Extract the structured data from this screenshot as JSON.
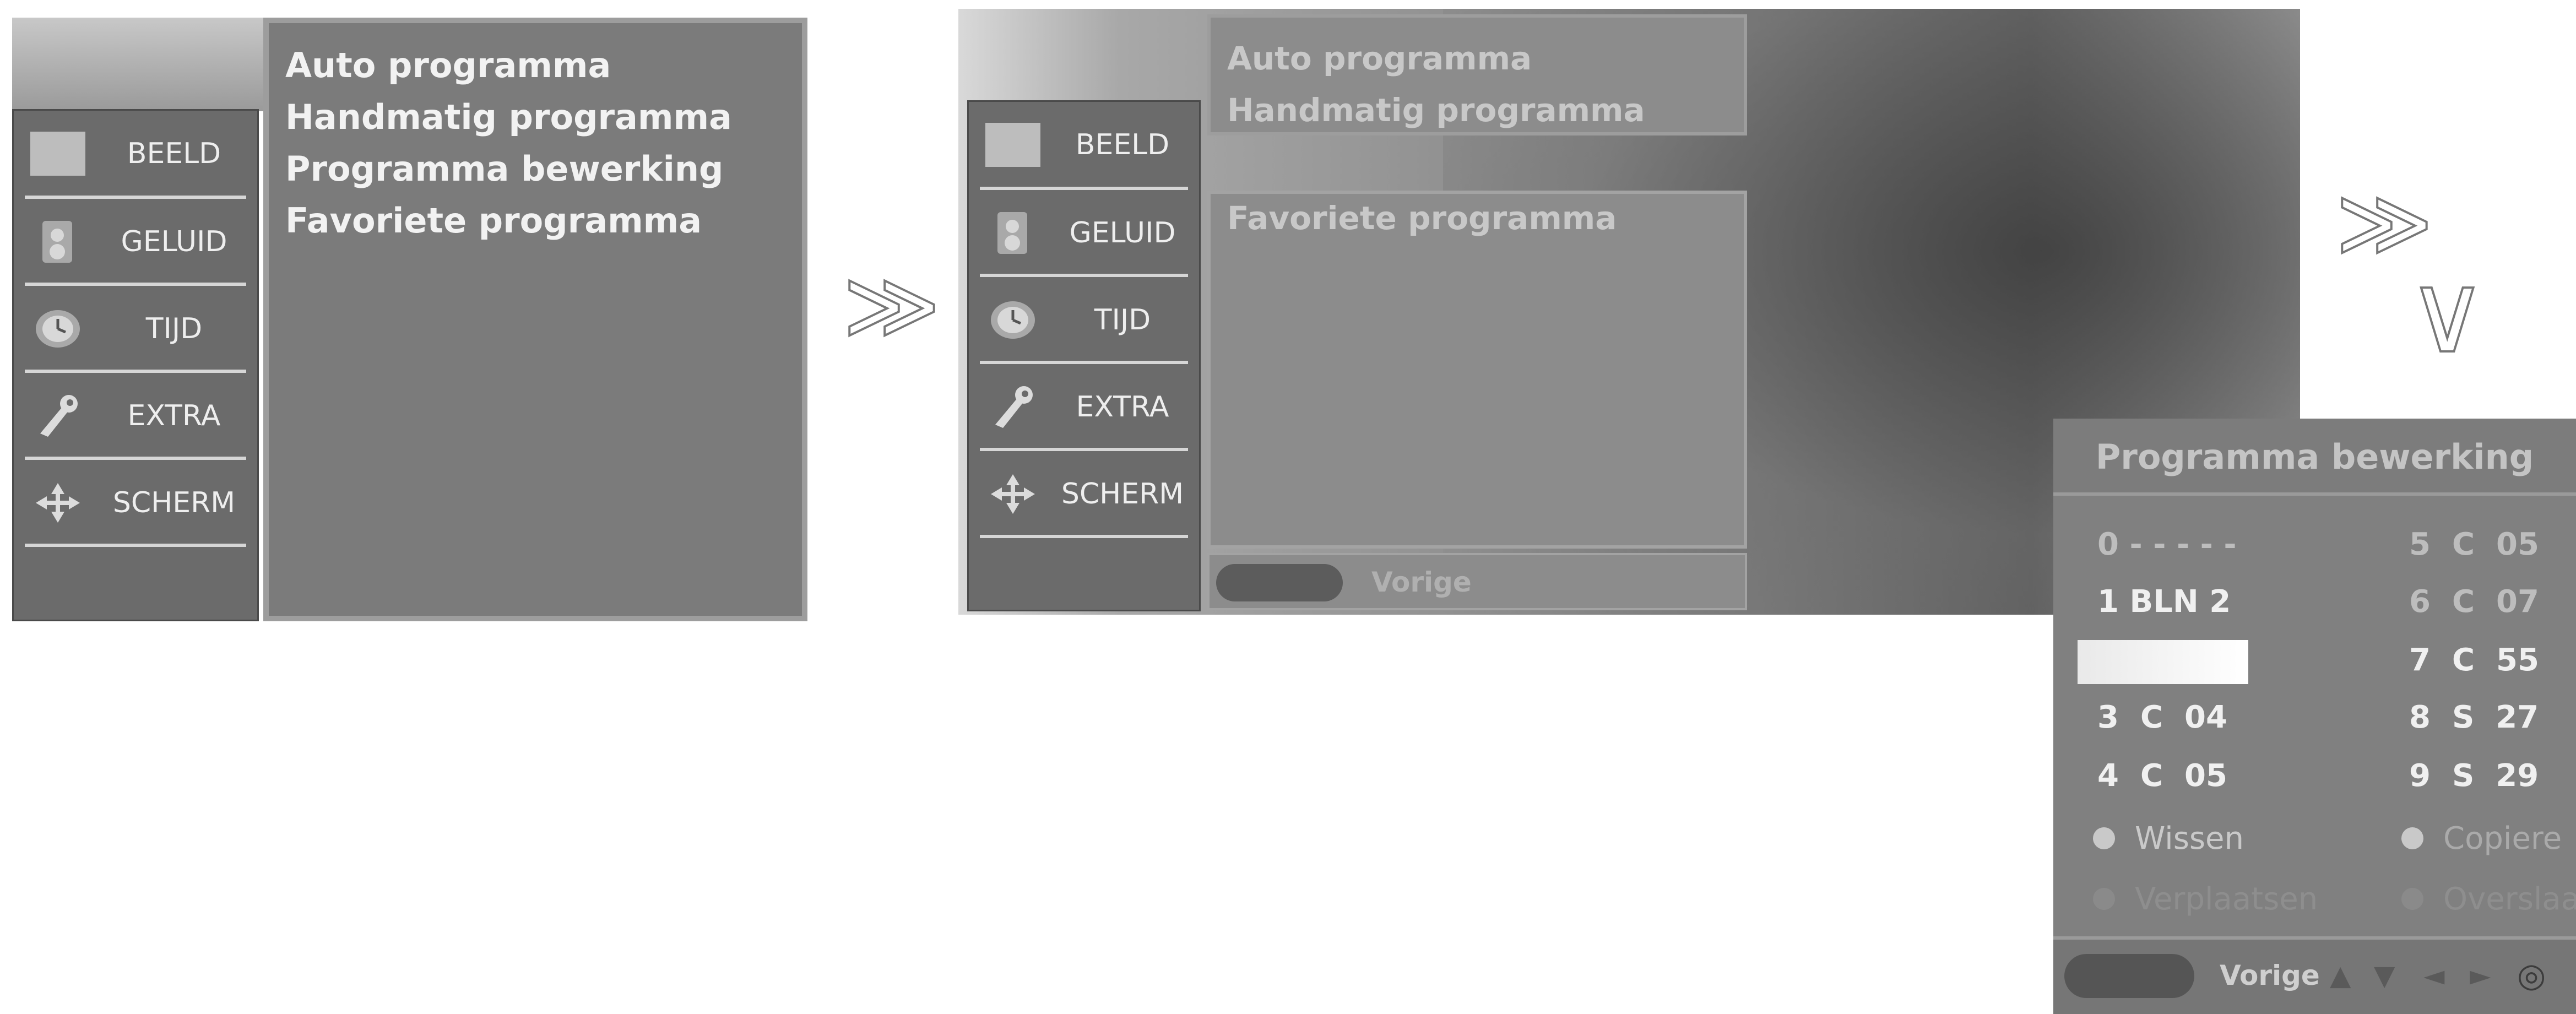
{
  "panel1": {
    "menu": [
      {
        "label": "BEELD",
        "icon": "picture-icon"
      },
      {
        "label": "GELUID",
        "icon": "speaker-icon"
      },
      {
        "label": "TIJD",
        "icon": "clock-icon"
      },
      {
        "label": "EXTRA",
        "icon": "wrench-icon"
      },
      {
        "label": "SCHERM",
        "icon": "move-icon"
      }
    ],
    "options": [
      "Auto programma",
      "Handmatig programma",
      "Programma bewerking",
      "Favoriete programma"
    ]
  },
  "arrow_right": "≫",
  "arrow_down": "∨",
  "panel2": {
    "menu": [
      {
        "label": "BEELD",
        "icon": "picture-icon"
      },
      {
        "label": "GELUID",
        "icon": "speaker-icon"
      },
      {
        "label": "TIJD",
        "icon": "clock-icon"
      },
      {
        "label": "EXTRA",
        "icon": "wrench-icon"
      },
      {
        "label": "SCHERM",
        "icon": "move-icon"
      }
    ],
    "options": [
      "Auto programma",
      "Handmatig programma",
      "Favoriete programma"
    ],
    "footer_label": "Vorige"
  },
  "panel3": {
    "title": "Programma bewerking",
    "left_col": [
      "0 - - - - -",
      "1 BLN 2",
      "",
      "3  C  04",
      "4  C  05"
    ],
    "right_col": [
      "5  C  05",
      "6  C  07",
      "7  C  55",
      "8  S  27",
      "9  S  29"
    ],
    "actions": [
      {
        "label": "Wissen",
        "color": "#c9c9c9"
      },
      {
        "label": "Copiere",
        "color": "#c9c9c9"
      },
      {
        "label": "Verplaatsen",
        "color": "#8a8a8a"
      },
      {
        "label": "Overslaan",
        "color": "#8a8a8a"
      }
    ],
    "footer_label": "Vorige",
    "nav_symbols": [
      "▲",
      "▼",
      "◄",
      "►",
      "◎"
    ]
  }
}
